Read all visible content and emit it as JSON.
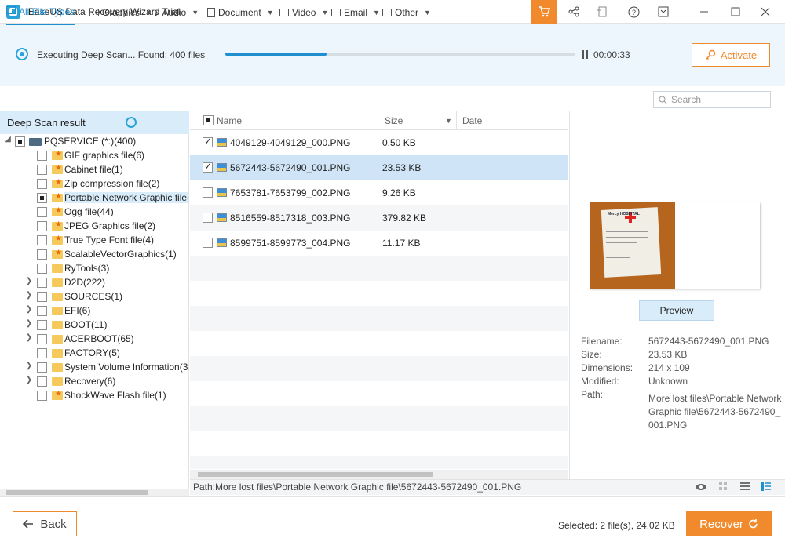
{
  "window": {
    "title": "EaseUS Data Recovery Wizard Trial",
    "controls": [
      "cart-icon",
      "share-icon",
      "feedback-icon",
      "help-icon",
      "menu-icon",
      "minimize-icon",
      "maximize-icon",
      "close-icon"
    ]
  },
  "scan": {
    "status": "Executing Deep Scan... Found: 400 files",
    "progress": 0.29,
    "elapsed": "00:00:33",
    "activate_label": "Activate"
  },
  "filters": {
    "tabs": [
      {
        "label": "All File Types",
        "icon": "monitor-icon",
        "active": true
      },
      {
        "label": "Graphics",
        "icon": "image-icon"
      },
      {
        "label": "Audio",
        "icon": "music-icon"
      },
      {
        "label": "Document",
        "icon": "document-icon"
      },
      {
        "label": "Video",
        "icon": "video-icon"
      },
      {
        "label": "Email",
        "icon": "email-icon"
      },
      {
        "label": "Other",
        "icon": "folder-icon"
      }
    ],
    "search_placeholder": "Search"
  },
  "tree": {
    "header": "Deep Scan result",
    "root": "PQSERVICE (*:)(400)",
    "items": [
      {
        "label": "GIF graphics file(6)",
        "star": true
      },
      {
        "label": "Cabinet file(1)",
        "star": true
      },
      {
        "label": "Zip compression file(2)",
        "star": true
      },
      {
        "label": "Portable Network Graphic file(",
        "star": true,
        "selected": true,
        "partial": true
      },
      {
        "label": "Ogg file(44)",
        "star": true
      },
      {
        "label": "JPEG Graphics file(2)",
        "star": true
      },
      {
        "label": "True Type Font file(4)",
        "star": true
      },
      {
        "label": "ScalableVectorGraphics(1)",
        "star": true
      },
      {
        "label": "RyTools(3)",
        "star": false
      },
      {
        "label": "D2D(222)",
        "star": false,
        "expandable": true
      },
      {
        "label": "SOURCES(1)",
        "star": false,
        "expandable": true
      },
      {
        "label": "EFI(6)",
        "star": false,
        "expandable": true
      },
      {
        "label": "BOOT(11)",
        "star": false,
        "expandable": true
      },
      {
        "label": "ACERBOOT(65)",
        "star": false,
        "expandable": true
      },
      {
        "label": "FACTORY(5)",
        "star": false
      },
      {
        "label": "System Volume Information(3",
        "star": false,
        "expandable": true
      },
      {
        "label": "Recovery(6)",
        "star": false,
        "expandable": true
      },
      {
        "label": "ShockWave Flash file(1)",
        "star": true
      }
    ]
  },
  "list": {
    "columns": {
      "name": "Name",
      "size": "Size",
      "date": "Date"
    },
    "rows": [
      {
        "name": "4049129-4049129_000.PNG",
        "size": "0.50 KB",
        "checked": true,
        "selected": false
      },
      {
        "name": "5672443-5672490_001.PNG",
        "size": "23.53 KB",
        "checked": true,
        "selected": true
      },
      {
        "name": "7653781-7653799_002.PNG",
        "size": "9.26 KB",
        "checked": false,
        "selected": false
      },
      {
        "name": "8516559-8517318_003.PNG",
        "size": "379.82 KB",
        "checked": false,
        "selected": false
      },
      {
        "name": "8599751-8599773_004.PNG",
        "size": "11.17 KB",
        "checked": false,
        "selected": false
      }
    ]
  },
  "preview": {
    "button": "Preview",
    "thumb_text": "Mercy HOSPITAL",
    "labels": {
      "filename": "Filename:",
      "size": "Size:",
      "dimensions": "Dimensions:",
      "modified": "Modified:",
      "path": "Path:"
    },
    "values": {
      "filename": "5672443-5672490_001.PNG",
      "size": "23.53 KB",
      "dimensions": "214 x 109",
      "modified": "Unknown",
      "path": "More lost files\\Portable Network Graphic file\\5672443-5672490_001.PNG"
    }
  },
  "status": {
    "path": "Path:More lost files\\Portable Network Graphic file\\5672443-5672490_001.PNG"
  },
  "footer": {
    "back_label": "Back",
    "selected": "Selected: 2 file(s), 24.02 KB",
    "recover_label": "Recover"
  },
  "colors": {
    "accent": "#f08a2c",
    "primary": "#1f8fd0",
    "header_bg": "#edf6fc",
    "selection": "#cfe5f7"
  }
}
